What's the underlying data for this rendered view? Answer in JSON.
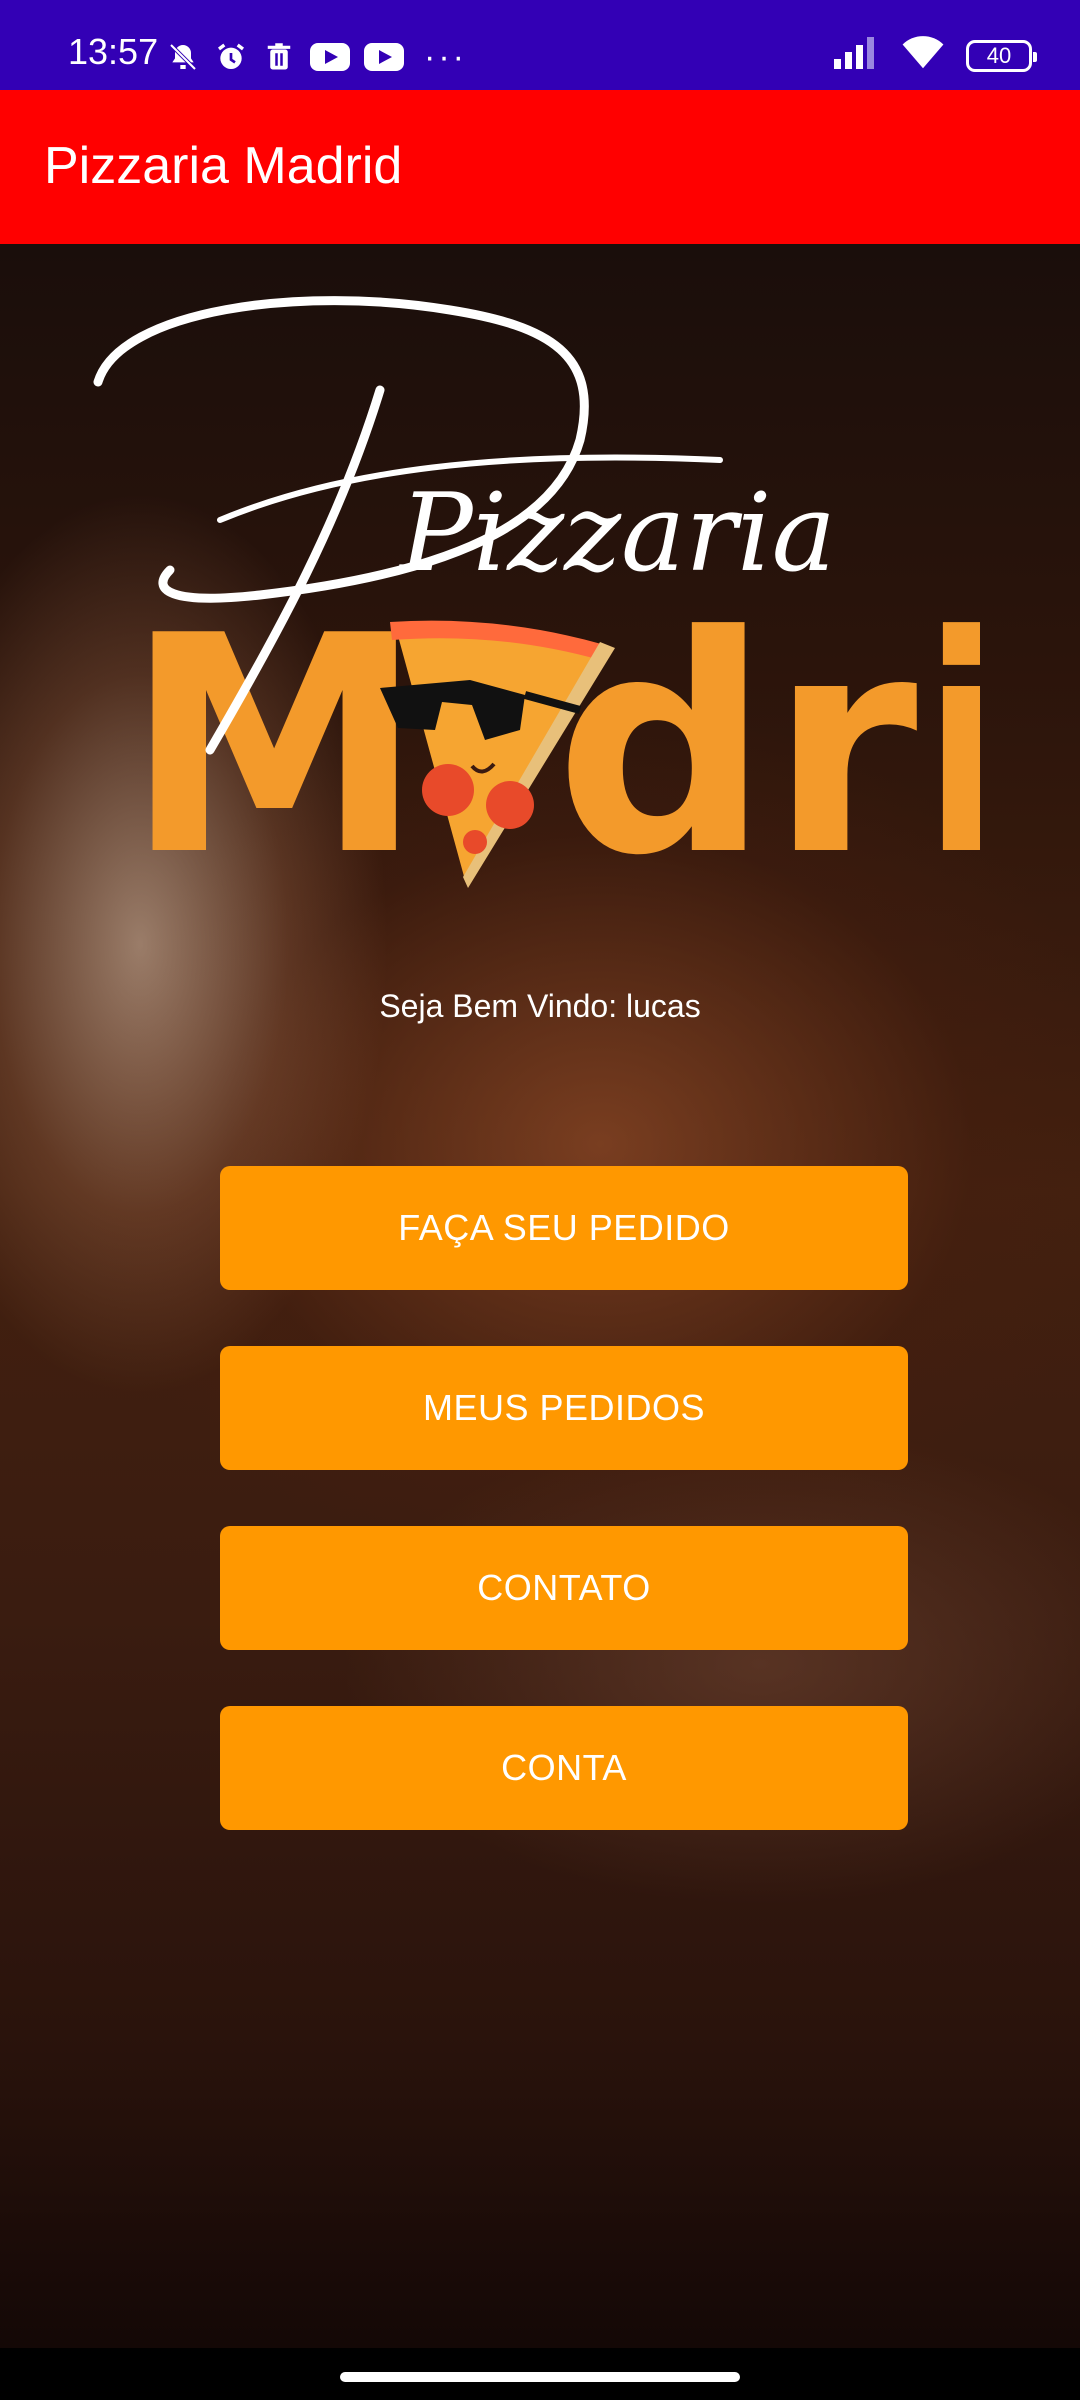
{
  "status_bar": {
    "time": "13:57",
    "battery": "40",
    "icons_left": [
      "mute-bell-icon",
      "alarm-icon",
      "trash-icon",
      "youtube-icon",
      "youtube-icon",
      "more-dots-icon"
    ],
    "icons_right": [
      "signal-icon",
      "wifi-icon",
      "battery-icon"
    ]
  },
  "app_bar": {
    "title": "Pizzaria Madrid"
  },
  "logo": {
    "script_text": "Pizzaria",
    "word_left": "M",
    "word_right": "dri"
  },
  "welcome_text": "Seja Bem Vindo: lucas",
  "buttons": [
    {
      "label": "FAÇA SEU PEDIDO"
    },
    {
      "label": "MEUS PEDIDOS"
    },
    {
      "label": "CONTATO"
    },
    {
      "label": "CONTA"
    }
  ],
  "colors": {
    "status_bar": "#3300b5",
    "app_bar": "#ff0000",
    "button": "#ff9800",
    "logo_orange": "#f39a2b"
  }
}
